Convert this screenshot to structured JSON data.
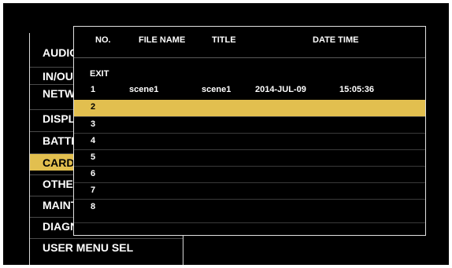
{
  "background_menu": {
    "items": [
      {
        "label": "AUDIO"
      },
      {
        "label": "IN/OUT"
      },
      {
        "label": "NETWORK"
      },
      {
        "label": "DISPLAY"
      },
      {
        "label": "BATTERY"
      },
      {
        "label": "CARD"
      },
      {
        "label": "OTHER"
      },
      {
        "label": "MAINTENANCE"
      },
      {
        "label": "DIAGNOSTIC"
      },
      {
        "label": "USER MENU SEL"
      }
    ],
    "selected": "CARD"
  },
  "dialog": {
    "headers": {
      "no": "NO.",
      "file_name": "FILE NAME",
      "title": "TITLE",
      "date_time": "DATE TIME"
    },
    "rows": [
      {
        "no": "EXIT",
        "file_name": "",
        "title": "",
        "date": "",
        "time": ""
      },
      {
        "no": "1",
        "file_name": "scene1",
        "title": "scene1",
        "date": "2014-JUL-09",
        "time": "15:05:36"
      },
      {
        "no": "2",
        "file_name": "",
        "title": "",
        "date": "",
        "time": ""
      },
      {
        "no": "3",
        "file_name": "",
        "title": "",
        "date": "",
        "time": ""
      },
      {
        "no": "4",
        "file_name": "",
        "title": "",
        "date": "",
        "time": ""
      },
      {
        "no": "5",
        "file_name": "",
        "title": "",
        "date": "",
        "time": ""
      },
      {
        "no": "6",
        "file_name": "",
        "title": "",
        "date": "",
        "time": ""
      },
      {
        "no": "7",
        "file_name": "",
        "title": "",
        "date": "",
        "time": ""
      },
      {
        "no": "8",
        "file_name": "",
        "title": "",
        "date": "",
        "time": ""
      }
    ],
    "selected_row": "2"
  },
  "colors": {
    "highlight": "#e2bf4f",
    "background": "#000000",
    "text": "#ffffff"
  }
}
